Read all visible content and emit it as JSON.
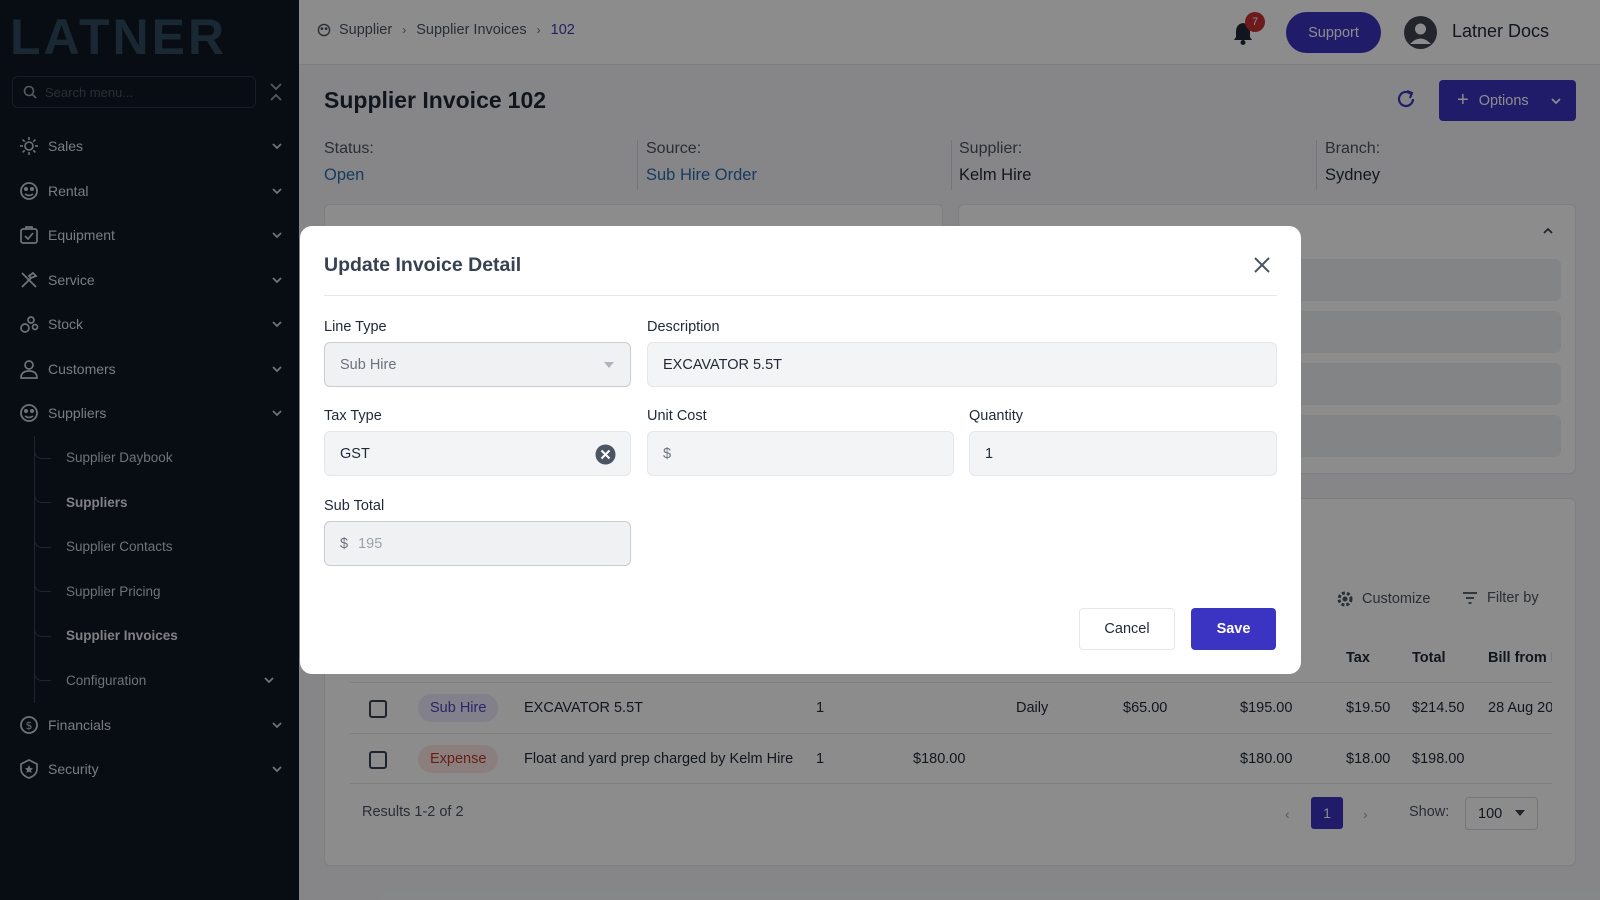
{
  "brand": {
    "logo_text": "LATNER"
  },
  "sidebar": {
    "search_placeholder": "Search menu...",
    "items": [
      {
        "label": "Sales",
        "icon": "sales-icon"
      },
      {
        "label": "Rental",
        "icon": "rental-icon"
      },
      {
        "label": "Equipment",
        "icon": "equipment-icon"
      },
      {
        "label": "Service",
        "icon": "service-icon"
      },
      {
        "label": "Stock",
        "icon": "stock-icon"
      },
      {
        "label": "Customers",
        "icon": "customers-icon"
      },
      {
        "label": "Suppliers",
        "icon": "suppliers-icon"
      },
      {
        "label": "Financials",
        "icon": "financials-icon"
      },
      {
        "label": "Security",
        "icon": "security-icon"
      }
    ],
    "suppliers_sub": [
      {
        "label": "Supplier Daybook"
      },
      {
        "label": "Suppliers"
      },
      {
        "label": "Supplier Contacts"
      },
      {
        "label": "Supplier Pricing"
      },
      {
        "label": "Supplier Invoices"
      },
      {
        "label": "Configuration"
      }
    ]
  },
  "header": {
    "breadcrumbs": [
      "Supplier",
      "Supplier Invoices",
      "102"
    ],
    "notification_count": "7",
    "support_label": "Support",
    "user_name": "Latner Docs"
  },
  "page": {
    "title": "Supplier Invoice",
    "invoice_number": "102",
    "options_label": "Options",
    "status_label": "Status:",
    "status_value": "Open",
    "source_label": "Source:",
    "source_value": "Sub Hire Order",
    "supplier_label": "Supplier:",
    "supplier_value": "Kelm Hire",
    "branch_label": "Branch:",
    "branch_value": "Sydney"
  },
  "table": {
    "customize_label": "Customize",
    "filter_label": "Filter by",
    "headers": [
      "Tax",
      "Total",
      "Bill from D"
    ],
    "rows": [
      {
        "type": "Sub Hire",
        "description": "EXCAVATOR 5.5T",
        "qty": "1",
        "unit_cost": "",
        "period": "Daily",
        "rate": "$65.00",
        "subtotal": "$195.00",
        "tax": "$19.50",
        "total": "$214.50",
        "bill_from": "28 Aug 20"
      },
      {
        "type": "Expense",
        "description": "Float and yard prep charged by Kelm Hire",
        "qty": "1",
        "unit_cost": "$180.00",
        "period": "",
        "rate": "",
        "subtotal": "$180.00",
        "tax": "$18.00",
        "total": "$198.00",
        "bill_from": ""
      }
    ],
    "results_text": "Results 1-2 of 2",
    "current_page": "1",
    "show_label": "Show:",
    "page_size": "100"
  },
  "modal": {
    "title": "Update Invoice Detail",
    "line_type_label": "Line Type",
    "line_type_value": "Sub Hire",
    "description_label": "Description",
    "description_value": "EXCAVATOR 5.5T",
    "tax_type_label": "Tax Type",
    "tax_type_value": "GST",
    "unit_cost_label": "Unit Cost",
    "unit_cost_prefix": "$",
    "unit_cost_value": "",
    "quantity_label": "Quantity",
    "quantity_value": "1",
    "sub_total_label": "Sub Total",
    "sub_total_prefix": "$",
    "sub_total_value": "195",
    "cancel_label": "Cancel",
    "save_label": "Save"
  },
  "colors": {
    "accent": "#3b34c2",
    "sidebar_bg": "#0f1623",
    "link": "#2b6cb0"
  }
}
